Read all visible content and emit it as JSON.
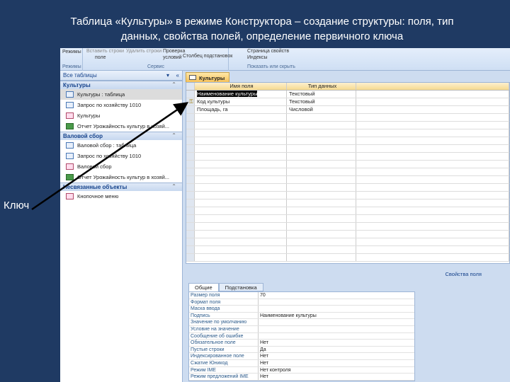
{
  "title": {
    "line1": "Таблица «Культуры» в режиме Конструктора – создание структуры: поля, тип",
    "line2": "данных, свойства полей, определение первичного ключа"
  },
  "annotation": {
    "key_label": "Ключ"
  },
  "ribbon": {
    "view_btn": "Режимы",
    "view_group": "Режимы",
    "insert_rows": "Вставить строки",
    "delete_rows": "Удалить строки",
    "field": "поле",
    "test_rules": "Проверка",
    "test_rules2": "условий",
    "lookup": "Столбец подстановок",
    "tools_group": "Сервис",
    "property_sheet": "Страница свойств",
    "indexes": "Индексы",
    "show_hide_group": "Показать или скрыть"
  },
  "nav": {
    "header": "Все таблицы",
    "groups": [
      {
        "name": "Культуры",
        "items": [
          {
            "label": "Культуры : таблица",
            "type": "table"
          },
          {
            "label": "Запрос по хозяйству 1010",
            "type": "query"
          },
          {
            "label": "Культуры",
            "type": "form"
          },
          {
            "label": "Отчет Урожайность культур в хозяй...",
            "type": "report"
          }
        ]
      },
      {
        "name": "Валовой сбор",
        "items": [
          {
            "label": "Валовой сбор : таблица",
            "type": "table"
          },
          {
            "label": "Запрос по хозяйству 1010",
            "type": "query"
          },
          {
            "label": "Валовой сбор",
            "type": "form"
          },
          {
            "label": "Отчет Урожайность культур в хозяй...",
            "type": "report"
          }
        ]
      },
      {
        "name": "Несвязанные объекты",
        "items": [
          {
            "label": "Кнопочное меню",
            "type": "form"
          }
        ]
      }
    ]
  },
  "design": {
    "tab": "Культуры",
    "col_name": "Имя поля",
    "col_type": "Тип данных",
    "rows": [
      {
        "name": "Наименование культуры",
        "type": "Текстовый"
      },
      {
        "name": "Код культуры",
        "type": "Текстовый",
        "key": true
      },
      {
        "name": "Площадь, га",
        "type": "Числовой"
      }
    ]
  },
  "props": {
    "label": "Свойства поля",
    "tab_general": "Общие",
    "tab_lookup": "Подстановка",
    "rows": [
      {
        "k": "Размер поля",
        "v": "70"
      },
      {
        "k": "Формат поля",
        "v": ""
      },
      {
        "k": "Маска ввода",
        "v": ""
      },
      {
        "k": "Подпись",
        "v": "Наименование культуры"
      },
      {
        "k": "Значение по умолчанию",
        "v": ""
      },
      {
        "k": "Условие на значение",
        "v": ""
      },
      {
        "k": "Сообщение об ошибке",
        "v": ""
      },
      {
        "k": "Обязательное поле",
        "v": "Нет"
      },
      {
        "k": "Пустые строки",
        "v": "Да"
      },
      {
        "k": "Индексированное поле",
        "v": "Нет"
      },
      {
        "k": "Сжатие Юникод",
        "v": "Нет"
      },
      {
        "k": "Режим IME",
        "v": "Нет контроля"
      },
      {
        "k": "Режим предложений IME",
        "v": "Нет"
      }
    ]
  }
}
